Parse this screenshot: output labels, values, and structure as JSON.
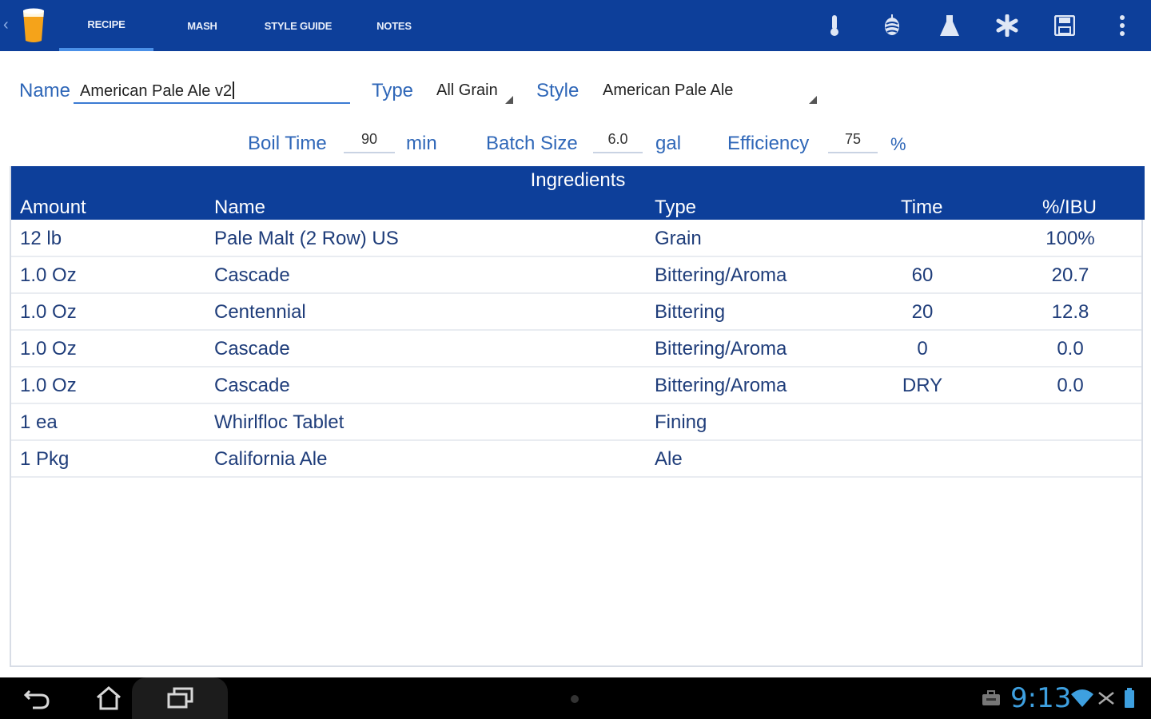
{
  "tabs": [
    {
      "label": "RECIPE",
      "active": true
    },
    {
      "label": "MASH",
      "active": false
    },
    {
      "label": "STYLE GUIDE",
      "active": false
    },
    {
      "label": "NOTES",
      "active": false
    }
  ],
  "action_icons": [
    "thermometer-icon",
    "hops-icon",
    "flask-icon",
    "asterisk-icon",
    "save-icon",
    "overflow-menu-icon"
  ],
  "form": {
    "name_label": "Name",
    "name_value": "American Pale Ale v2",
    "type_label": "Type",
    "type_value": "All Grain",
    "style_label": "Style",
    "style_value": "American Pale Ale",
    "boil_label": "Boil Time",
    "boil_value": "90",
    "boil_unit": "min",
    "batch_label": "Batch Size",
    "batch_value": "6.0",
    "batch_unit": "gal",
    "eff_label": "Efficiency",
    "eff_value": "75",
    "eff_unit": "%"
  },
  "ingredients": {
    "title": "Ingredients",
    "columns": [
      "Amount",
      "Name",
      "Type",
      "Time",
      "%/IBU"
    ],
    "rows": [
      [
        "12 lb",
        "Pale Malt (2 Row) US",
        "Grain",
        "",
        "100%"
      ],
      [
        "1.0 Oz",
        "Cascade",
        "Bittering/Aroma",
        "60",
        "20.7"
      ],
      [
        "1.0 Oz",
        "Centennial",
        "Bittering",
        "20",
        "12.8"
      ],
      [
        "1.0 Oz",
        "Cascade",
        "Bittering/Aroma",
        "0",
        "0.0"
      ],
      [
        "1.0 Oz",
        "Cascade",
        "Bittering/Aroma",
        "DRY",
        "0.0"
      ],
      [
        "1 ea",
        "Whirlfloc Tablet",
        "Fining",
        "",
        ""
      ],
      [
        "1 Pkg",
        "California Ale",
        "Ale",
        "",
        ""
      ]
    ]
  },
  "status": {
    "time": "9:13"
  },
  "colors": {
    "bar": "#0d3f9a",
    "accent": "#4a90e8",
    "label": "#2f67b8",
    "clock": "#3ea0e0"
  }
}
